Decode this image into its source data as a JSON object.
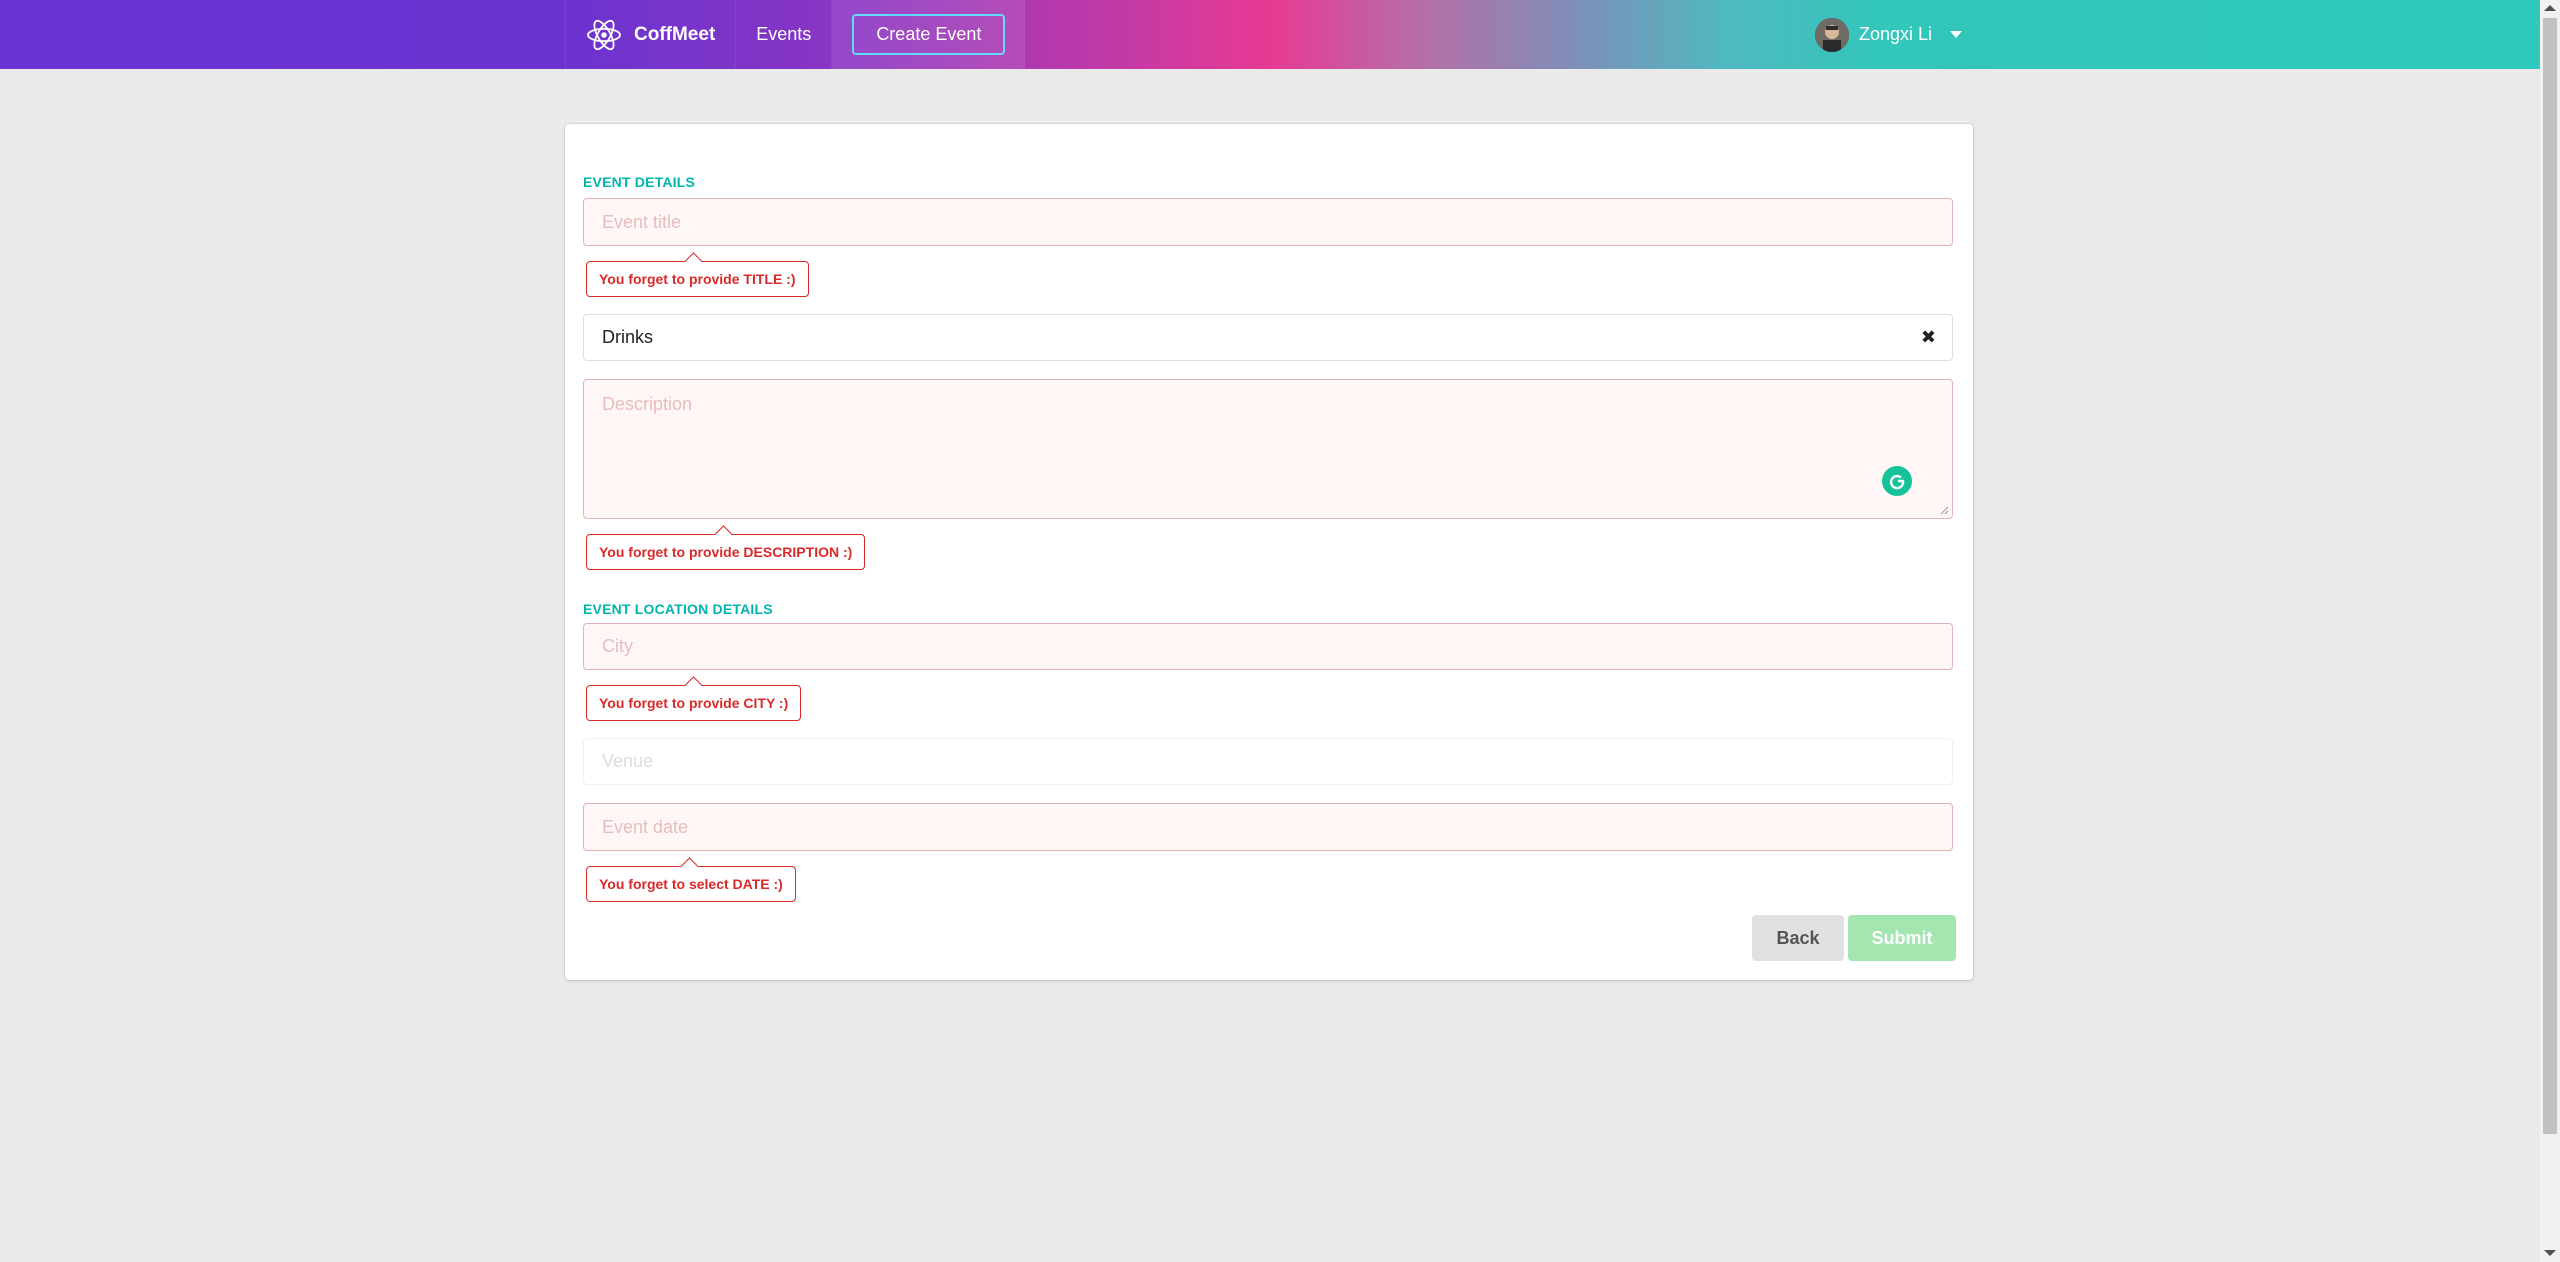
{
  "navbar": {
    "brand": "CoffMeet",
    "nav_events": "Events",
    "nav_create_event": "Create Event",
    "user_name": "Zongxi Li",
    "icons": {
      "brand": "react-atom-icon",
      "user_menu": "caret-down-icon"
    }
  },
  "form": {
    "event_details_header": "EVENT DETAILS",
    "title_placeholder": "Event title",
    "title_error": "You forget to provide TITLE :)",
    "category_value": "Drinks",
    "category_clear_icon": "close-icon",
    "description_placeholder": "Description",
    "description_error": "You forget to provide DESCRIPTION :)",
    "location_header": "EVENT LOCATION DETAILS",
    "city_placeholder": "City",
    "city_error": "You forget to provide CITY :)",
    "venue_placeholder": "Venue",
    "date_placeholder": "Event date",
    "date_error": "You forget to select DATE :)",
    "back_label": "Back",
    "submit_label": "Submit"
  },
  "colors": {
    "accent_teal": "#00b5ad",
    "error_red": "#db2828",
    "error_bg": "#fff6f6",
    "submit_green": "#a3e6b0",
    "create_border": "#61dafb"
  }
}
